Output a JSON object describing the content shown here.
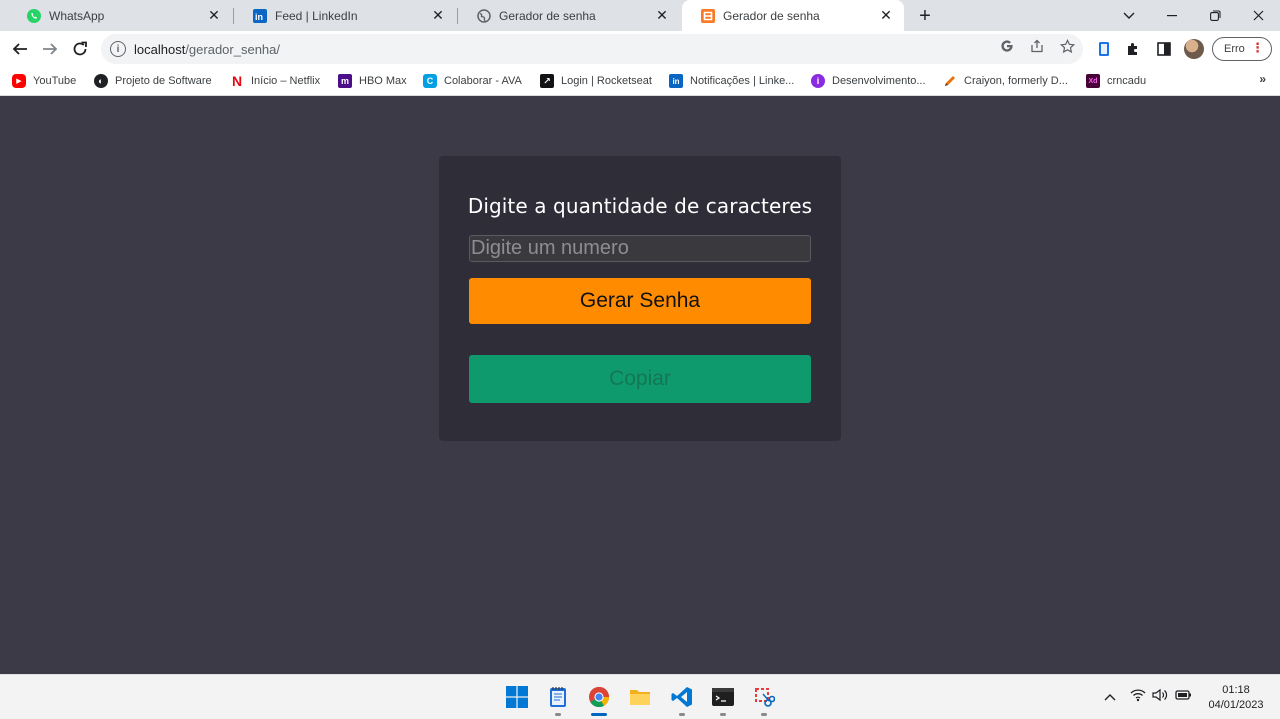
{
  "browser": {
    "tabs": [
      {
        "title": "WhatsApp",
        "icon": "whatsapp-icon",
        "active": false
      },
      {
        "title": "Feed | LinkedIn",
        "icon": "linkedin-icon",
        "active": false
      },
      {
        "title": "Gerador de senha",
        "icon": "globe-icon",
        "active": false
      },
      {
        "title": "Gerador de senha",
        "icon": "xampp-icon",
        "active": true
      }
    ],
    "new_tab": "+",
    "url_host": "localhost",
    "url_path": "/gerador_senha/",
    "profile_button": "Erro",
    "bookmarks": [
      {
        "label": "YouTube",
        "icon": "youtube-icon",
        "color": "#ff0000"
      },
      {
        "label": "Projeto de Software",
        "icon": "globe-icon",
        "color": "#202124"
      },
      {
        "label": "Início – Netflix",
        "icon": "netflix-icon",
        "color": "#e50914"
      },
      {
        "label": "HBO Max",
        "icon": "hbomax-icon",
        "color": "#4b0f8a"
      },
      {
        "label": "Colaborar - AVA",
        "icon": "colaborar-icon",
        "color": "#00a0e3"
      },
      {
        "label": "Login | Rocketseat",
        "icon": "rocketseat-icon",
        "color": "#121214"
      },
      {
        "label": "Notificações | Linke...",
        "icon": "linkedin-icon",
        "color": "#0a66c2"
      },
      {
        "label": "Desenvolvimento...",
        "icon": "dev-icon",
        "color": "#8a2be2"
      },
      {
        "label": "Craiyon, formerly D...",
        "icon": "pencil-icon",
        "color": "#e8710a"
      },
      {
        "label": "crncadu",
        "icon": "xd-icon",
        "color": "#470137"
      }
    ],
    "more_bookmarks": "»"
  },
  "app": {
    "heading": "Digite a quantidade de caracteres",
    "input_placeholder": "Digite um numero",
    "input_value": "",
    "generate_button": "Gerar Senha",
    "copy_button": "Copiar",
    "colors": {
      "background": "#3c3a46",
      "card": "#2f2d37",
      "generate": "#ff8c00",
      "copy": "#0f9a6e"
    }
  },
  "taskbar": {
    "apps": [
      "windows-start-icon",
      "notepad-icon",
      "chrome-icon",
      "file-explorer-icon",
      "vscode-icon",
      "terminal-icon",
      "snipping-tool-icon"
    ],
    "time": "01:18",
    "date": "04/01/2023"
  }
}
